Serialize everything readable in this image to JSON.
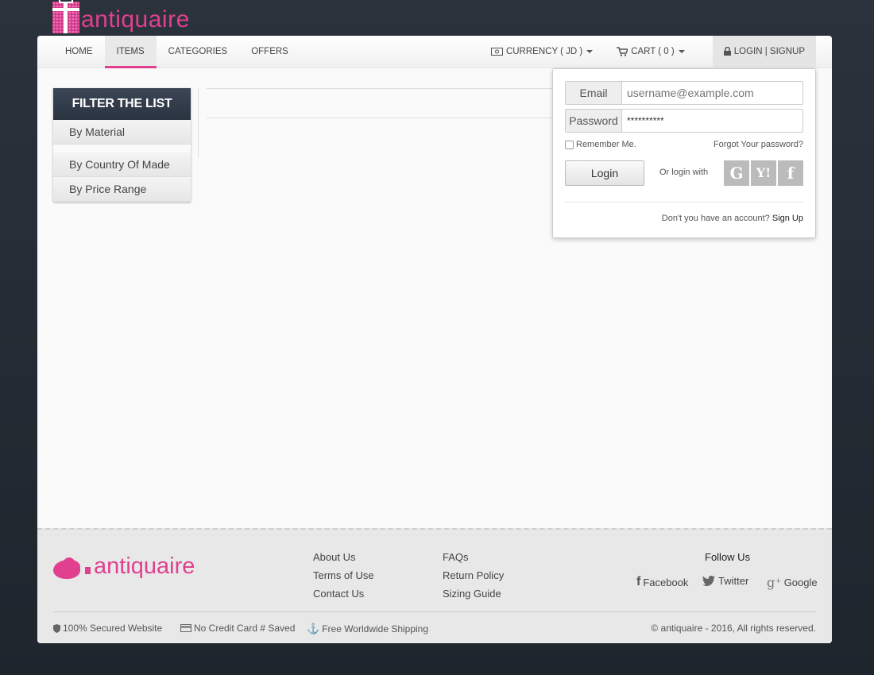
{
  "brand": {
    "name": "antiquaire",
    "accent": "#e0408f"
  },
  "nav": {
    "items": [
      {
        "label": "HOME"
      },
      {
        "label": "ITEMS"
      },
      {
        "label": "CATEGORIES"
      },
      {
        "label": "OFFERS"
      }
    ],
    "active": "ITEMS",
    "currency": "CURRENCY ( JD )",
    "cart": "CART ( 0 )",
    "login": "LOGIN | SIGNUP"
  },
  "filter": {
    "title": "FILTER THE LIST",
    "items": [
      "By Material",
      "By Country Of Made",
      "By Price Range"
    ]
  },
  "login": {
    "email_label": "Email",
    "email_placeholder": "username@example.com",
    "password_label": "Password",
    "password_value": "**********",
    "remember": "Remember Me.",
    "forgot": "Forgot Your password?",
    "button": "Login",
    "or_login_with": "Or login with",
    "social_icons": [
      "google-icon",
      "yahoo-icon",
      "facebook-icon"
    ],
    "no_account": "Don't you have an account?",
    "signup": "Sign Up"
  },
  "footer": {
    "links_col1": [
      "About Us",
      "Terms of Use",
      "Contact Us"
    ],
    "links_col2": [
      "FAQs",
      "Return Policy",
      "Sizing Guide"
    ],
    "follow_title": "Follow Us",
    "social": [
      "Facebook",
      "Twitter",
      "Google"
    ],
    "badges": [
      "100% Secured Website",
      "No Credit Card # Saved",
      "Free Worldwide Shipping"
    ],
    "copyright": "© antiquaire - 2016, All rights reserved."
  }
}
